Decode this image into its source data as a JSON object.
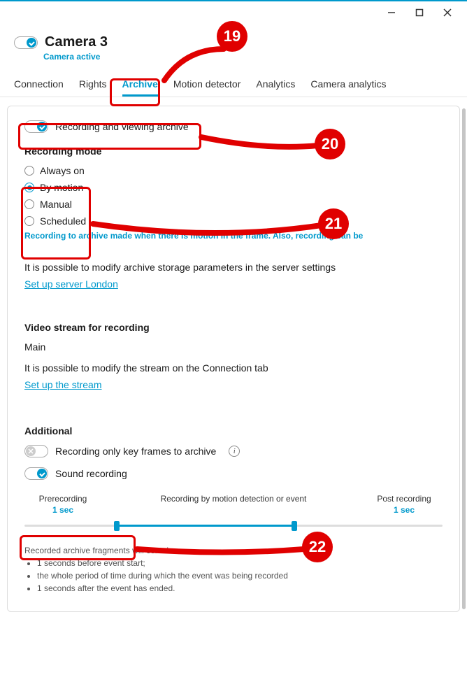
{
  "header": {
    "title": "Camera 3",
    "subtitle": "Camera active"
  },
  "tabs": [
    {
      "label": "Connection",
      "active": false
    },
    {
      "label": "Rights",
      "active": false
    },
    {
      "label": "Archive",
      "active": true
    },
    {
      "label": "Motion detector",
      "active": false
    },
    {
      "label": "Analytics",
      "active": false
    },
    {
      "label": "Camera analytics",
      "active": false
    }
  ],
  "archive": {
    "toggle_label": "Recording and viewing archive",
    "recording_mode_title": "Recording mode",
    "modes": [
      {
        "label": "Always on",
        "checked": false
      },
      {
        "label": "By motion",
        "checked": true
      },
      {
        "label": "Manual",
        "checked": false
      },
      {
        "label": "Scheduled",
        "checked": false
      }
    ],
    "mode_hint": "Recording to archive made when there is motion in the frame. Also, recording can be",
    "storage_desc": "It is possible to modify archive storage parameters in the server settings",
    "storage_link": "Set up server London",
    "stream_title": "Video stream for recording",
    "stream_value": "Main",
    "stream_desc": "It is possible to modify the stream on the Connection tab",
    "stream_link": "Set up the stream",
    "additional_title": "Additional",
    "keyframes_label": "Recording only key frames to archive",
    "sound_label": "Sound recording",
    "slider": {
      "pre_label": "Prerecording",
      "pre_value": "1 sec",
      "mid_label": "Recording by motion detection or event",
      "post_label": "Post recording",
      "post_value": "1 sec"
    },
    "footer": {
      "intro": "Recorded archive fragments will contain:",
      "b1": "1 seconds before event start;",
      "b2": "the whole period of time during which the event was being recorded",
      "b3": "1 seconds after the event has ended."
    }
  },
  "annotations": {
    "n19": "19",
    "n20": "20",
    "n21": "21",
    "n22": "22"
  }
}
